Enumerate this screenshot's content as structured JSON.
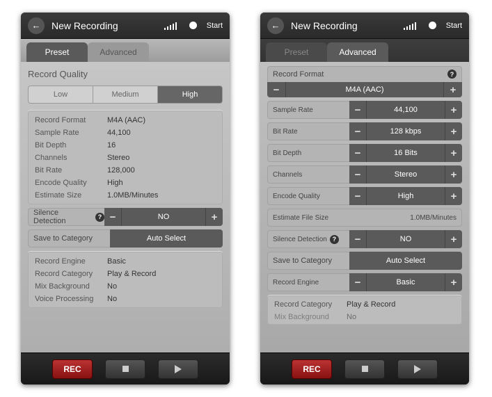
{
  "header": {
    "title": "New Recording",
    "start_label": "Start"
  },
  "tabs": {
    "preset": "Preset",
    "advanced": "Advanced"
  },
  "preset_view": {
    "section_title": "Record Quality",
    "quality": {
      "low": "Low",
      "medium": "Medium",
      "high": "High"
    },
    "info": {
      "record_format_k": "Record Format",
      "record_format_v": "M4A (AAC)",
      "sample_rate_k": "Sample Rate",
      "sample_rate_v": "44,100",
      "bit_depth_k": "Bit Depth",
      "bit_depth_v": "16",
      "channels_k": "Channels",
      "channels_v": "Stereo",
      "bit_rate_k": "Bit Rate",
      "bit_rate_v": "128,000",
      "encode_q_k": "Encode Quality",
      "encode_q_v": "High",
      "est_k": "Estimate Size",
      "est_v": "1.0MB/Minutes"
    },
    "silence_label": "Silence Detection",
    "silence_value": "NO",
    "save_cat_label": "Save to Category",
    "save_cat_value": "Auto Select",
    "engine": {
      "record_engine_k": "Record Engine",
      "record_engine_v": "Basic",
      "record_cat_k": "Record Category",
      "record_cat_v": "Play & Record",
      "mix_bg_k": "Mix Background",
      "mix_bg_v": "No",
      "voice_k": "Voice Processing",
      "voice_v": "No"
    }
  },
  "advanced_view": {
    "format_label": "Record Format",
    "format_value": "M4A (AAC)",
    "sample_rate_label": "Sample Rate",
    "sample_rate_value": "44,100",
    "bit_rate_label": "Bit Rate",
    "bit_rate_value": "128 kbps",
    "bit_depth_label": "Bit Depth",
    "bit_depth_value": "16 Bits",
    "channels_label": "Channels",
    "channels_value": "Stereo",
    "encode_q_label": "Encode Quality",
    "encode_q_value": "High",
    "est_label": "Estimate File Size",
    "est_value": "1.0MB/Minutes",
    "silence_label": "Silence Detection",
    "silence_value": "NO",
    "save_cat_label": "Save to Category",
    "save_cat_value": "Auto Select",
    "engine_label": "Record Engine",
    "engine_value": "Basic",
    "record_cat_k": "Record Category",
    "record_cat_v": "Play & Record",
    "mix_bg_k": "Mix Background",
    "mix_bg_v": "No"
  },
  "bottom": {
    "rec": "REC"
  }
}
